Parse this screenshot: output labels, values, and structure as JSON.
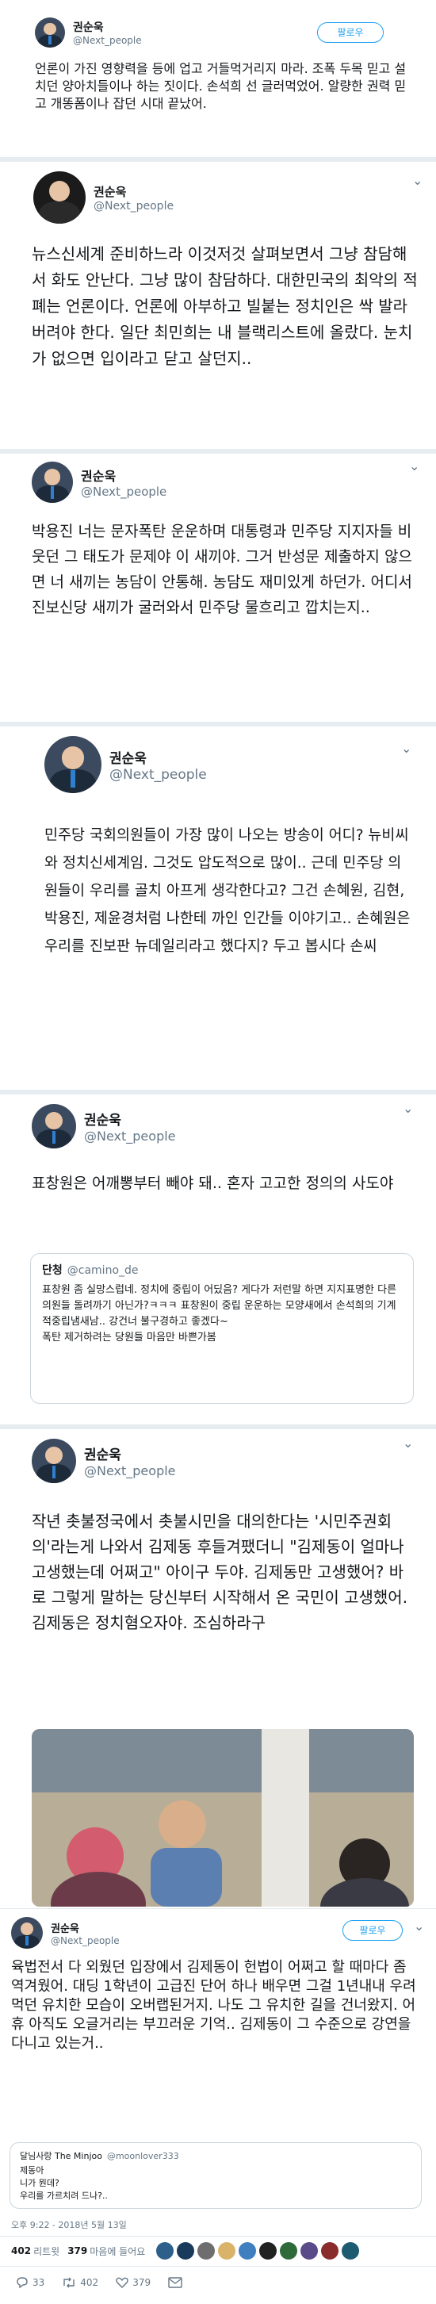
{
  "author": {
    "name": "권순욱",
    "handle": "@Next_people"
  },
  "tweets": [
    {
      "text": "언론이 가진 영향력을 등에 업고 거들먹거리지 마라. 조폭 두목 믿고 설치던 양아치들이나 하는 짓이다. 손석희 선 글러먹었어. 알량한 권력 믿고 개똥폼이나 잡던 시대 끝났어.",
      "follow_label": "팔로우"
    },
    {
      "text": "뉴스신세계 준비하느라 이것저것 살펴보면서 그냥 참담해서 화도 안난다. 그냥 많이 참담하다. 대한민국의 최악의 적폐는 언론이다. 언론에 아부하고 빌붙는 정치인은 싹 발라버려야 한다. 일단 최민희는 내 블랙리스트에 올랐다. 눈치가 없으면 입이라고 닫고 살던지.."
    },
    {
      "text": "박용진 너는 문자폭탄 운운하며 대통령과 민주당 지지자들 비웃던 그 태도가 문제야 이 새끼야. 그거 반성문 제출하지 않으면 너 새끼는 농담이 안통해. 농담도 재미있게 하던가. 어디서 진보신당 새끼가 굴러와서 민주당 물흐리고 깝치는지.."
    },
    {
      "text": "민주당 국회의원들이 가장 많이 나오는 방송이 어디? 뉴비씨와 정치신세계임. 그것도 압도적으로 많이.. 근데 민주당 의원들이 우리를 골치 아프게 생각한다고? 그건 손혜원, 김현, 박용진, 제윤경처럼 나한테 까인 인간들 이야기고.. 손혜원은 우리를 진보판 뉴데일리라고 했다지? 두고 봅시다 손씨"
    },
    {
      "text": "표창원은 어깨뽕부터 빼야 돼.. 혼자 고고한 정의의 사도야",
      "quote": {
        "name": "단청",
        "handle": "@camino_de",
        "text": "표창원 좀 실망스럽네. 정치에 중립이 어딨음? 게다가 저런말 하면 지지표명한 다른 의원들 돌려까기 아닌가?ㅋㅋㅋ 표창원이 중립 운운하는 모양새에서 손석희의 기계적중립냄새남.. 강건너 불구경하고 좋겠다~\n폭탄 제거하려는 당원들 마음만 바쁜가봄"
      }
    },
    {
      "text": "작년 촛불정국에서 촛불시민을 대의한다는 '시민주권회의'라는게 나와서 김제동 후들겨팼더니 \"김제동이 얼마나 고생했는데 어쩌고\" 아이구 두야. 김제동만 고생했어? 바로 그렇게 말하는 당신부터 시작해서 온 국민이 고생했어. 김제동은 정치혐오자야. 조심하라구"
    },
    {
      "text": "육법전서 다 외웠던 입장에서 김제동이 헌법이 어쩌고 할 때마다 좀 역겨웠어. 대딩 1학년이 고급진 단어 하나 배우면 그걸 1년내내 우려먹던 유치한 모습이 오버랩된거지. 나도 그 유치한 길을 건너왔지. 어휴 아직도 오글거리는 부끄러운 기억.. 김제동이 그 수준으로 강연을 다니고 있는거..",
      "follow_label": "팔로우",
      "quote": {
        "name": "달님사랑 The Minjoo",
        "handle": "@moonlover333",
        "text": "제동아\n니가 뭔데?\n우리를 가르치려 드나?.."
      },
      "timestamp": "오후 9:22 - 2018년 5월 13일",
      "retweets_count": "402",
      "retweets_label": "리트윗",
      "likes_count": "379",
      "likes_label": "마음에 들어요",
      "reply_count": "33",
      "retweet_action_count": "402",
      "like_action_count": "379"
    }
  ],
  "colors": {
    "accent": "#1da1f2",
    "divider": "#e6ecf0",
    "muted": "#657786"
  }
}
